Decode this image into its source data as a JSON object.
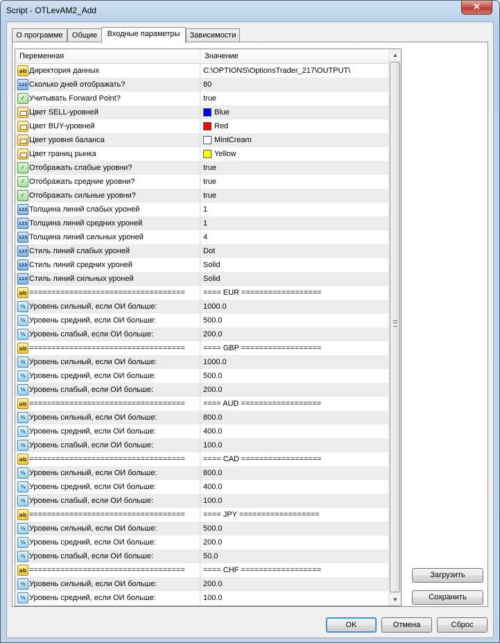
{
  "window": {
    "title": "Script - OTLevAM2_Add",
    "close_glyph": "✕"
  },
  "tabs": [
    {
      "label": "О программе"
    },
    {
      "label": "Общие"
    },
    {
      "label": "Входные параметры",
      "active": true
    },
    {
      "label": "Зависимости"
    }
  ],
  "grid": {
    "headers": {
      "name": "Переменная",
      "value": "Значение"
    },
    "rows": [
      {
        "type": "ab",
        "name": "Директория данных",
        "value": "C:\\OPTIONS\\OptionsTrader_217\\OUTPUT\\"
      },
      {
        "type": "int",
        "name": "Сколько дней отображать?",
        "value": "80"
      },
      {
        "type": "bool",
        "name": "Учитывать Forward Point?",
        "value": "true"
      },
      {
        "type": "color",
        "name": "Цвет SELL-уровней",
        "value": "Blue",
        "swatch": "#0000ff"
      },
      {
        "type": "color",
        "name": "Цвет BUY-уровней",
        "value": "Red",
        "swatch": "#ff0000"
      },
      {
        "type": "color",
        "name": "Цвет уровня баланса",
        "value": "MintCream",
        "swatch": "#f5fffa"
      },
      {
        "type": "color",
        "name": "Цвет границ рынка",
        "value": "Yellow",
        "swatch": "#ffff00"
      },
      {
        "type": "bool",
        "name": "Отображать слабые уровни?",
        "value": "true"
      },
      {
        "type": "bool",
        "name": "Отображать средние уровни?",
        "value": "true"
      },
      {
        "type": "bool",
        "name": "Отображать сильные уровни?",
        "value": "true"
      },
      {
        "type": "int",
        "name": "Толщина линий слабых уроней",
        "value": "1"
      },
      {
        "type": "int",
        "name": "Толщина линий средних уроней",
        "value": "1"
      },
      {
        "type": "int",
        "name": "Толщина линий сильных уроней",
        "value": "4"
      },
      {
        "type": "int",
        "name": "Стиль линий слабых уроней",
        "value": "Dot"
      },
      {
        "type": "int",
        "name": "Стиль линий средних уроней",
        "value": "Solid"
      },
      {
        "type": "int",
        "name": "Стиль линий сильных уроней",
        "value": "Solid"
      },
      {
        "type": "ab",
        "name": "===================================",
        "value": "==== EUR =================="
      },
      {
        "type": "dbl",
        "name": "Уровень сильный, если ОИ больше:",
        "value": "1000.0"
      },
      {
        "type": "dbl",
        "name": "Уровень средний, если ОИ больше:",
        "value": "500.0"
      },
      {
        "type": "dbl",
        "name": "Уровень слабый, если ОИ больше:",
        "value": "200.0"
      },
      {
        "type": "ab",
        "name": "===================================",
        "value": "==== GBP =================="
      },
      {
        "type": "dbl",
        "name": "Уровень сильный, если ОИ больше:",
        "value": "1000.0"
      },
      {
        "type": "dbl",
        "name": "Уровень средний, если ОИ больше:",
        "value": "500.0"
      },
      {
        "type": "dbl",
        "name": "Уровень слабый, если ОИ больше:",
        "value": "200.0"
      },
      {
        "type": "ab",
        "name": "===================================",
        "value": "==== AUD =================="
      },
      {
        "type": "dbl",
        "name": "Уровень сильный, если ОИ больше:",
        "value": "800.0"
      },
      {
        "type": "dbl",
        "name": "Уровень средний, если ОИ больше:",
        "value": "400.0"
      },
      {
        "type": "dbl",
        "name": "Уровень слабый, если ОИ больше:",
        "value": "100.0"
      },
      {
        "type": "ab",
        "name": "===================================",
        "value": "==== CAD =================="
      },
      {
        "type": "dbl",
        "name": "Уровень сильный, если ОИ больше:",
        "value": "800.0"
      },
      {
        "type": "dbl",
        "name": "Уровень средний, если ОИ больше:",
        "value": "400.0"
      },
      {
        "type": "dbl",
        "name": "Уровень слабый, если ОИ больше:",
        "value": "100.0"
      },
      {
        "type": "ab",
        "name": "===================================",
        "value": "==== JPY =================="
      },
      {
        "type": "dbl",
        "name": "Уровень сильный, если ОИ больше:",
        "value": "500.0"
      },
      {
        "type": "dbl",
        "name": "Уровень средний, если ОИ больше:",
        "value": "200.0"
      },
      {
        "type": "dbl",
        "name": "Уровень слабый, если ОИ больше:",
        "value": "50.0"
      },
      {
        "type": "ab",
        "name": "===================================",
        "value": "==== CHF =================="
      },
      {
        "type": "dbl",
        "name": "Уровень сильный, если ОИ больше:",
        "value": "200.0"
      },
      {
        "type": "dbl",
        "name": "Уровень средний, если ОИ больше:",
        "value": "100.0"
      }
    ]
  },
  "side_buttons": {
    "load": "Загрузить",
    "save": "Сохранить"
  },
  "footer_buttons": {
    "ok": "OK",
    "cancel": "Отмена",
    "reset": "Сброс"
  },
  "icons": {
    "ab": "ab",
    "int": "123",
    "bool": "✓",
    "color": "",
    "dbl": "½"
  }
}
